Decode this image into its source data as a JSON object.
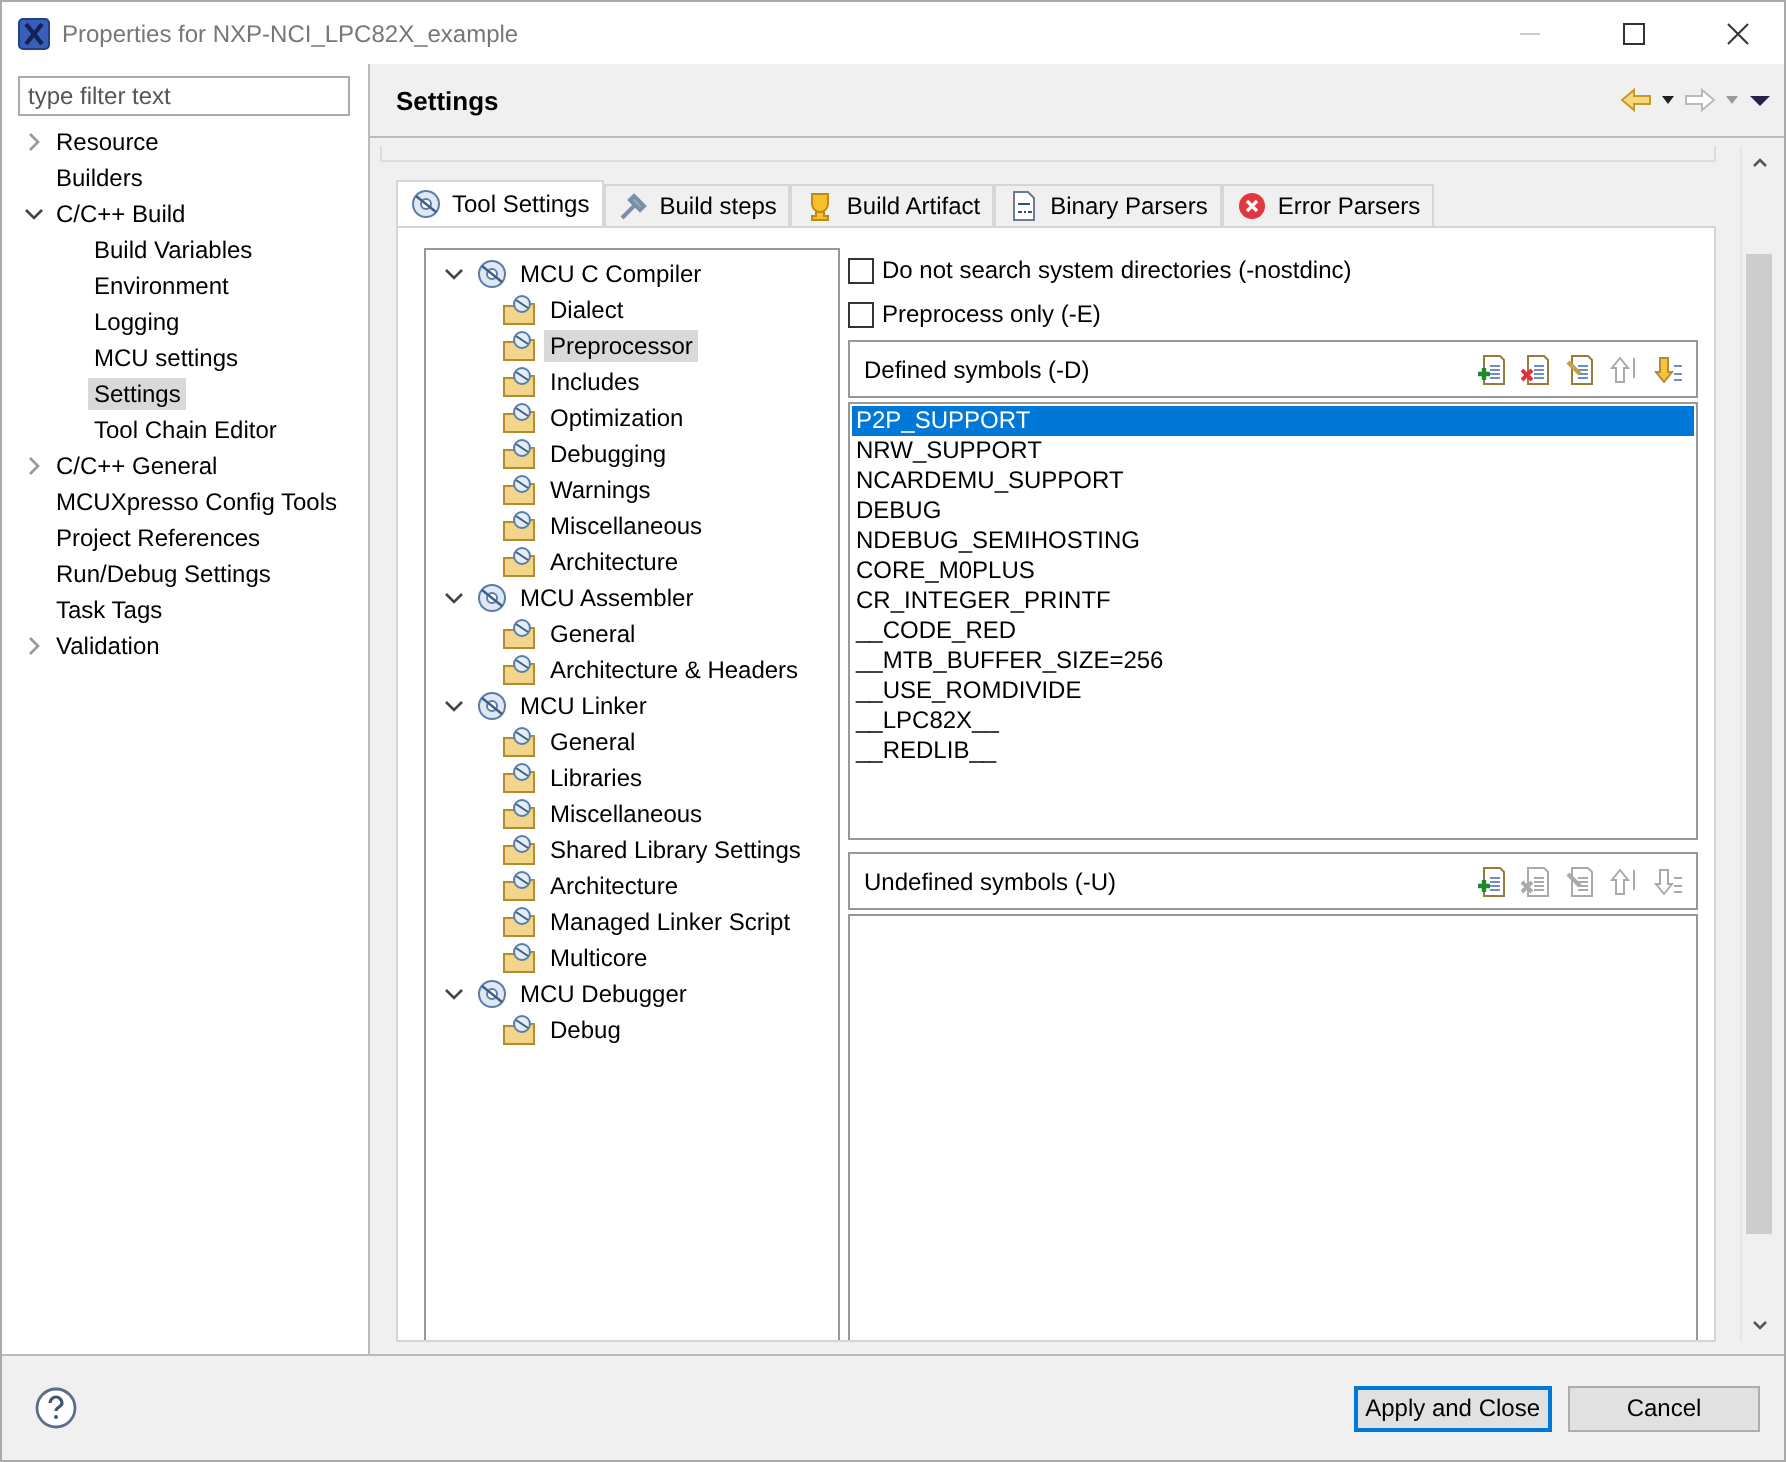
{
  "window": {
    "title": "Properties for NXP-NCI_LPC82X_example"
  },
  "sidebar": {
    "filter_placeholder": "type filter text",
    "items": [
      {
        "label": "Resource",
        "expanded": false,
        "selected": false
      },
      {
        "label": "Builders",
        "selected": false
      },
      {
        "label": "C/C++ Build",
        "expanded": true,
        "selected": false,
        "children": [
          {
            "label": "Build Variables",
            "selected": false
          },
          {
            "label": "Environment",
            "selected": false
          },
          {
            "label": "Logging",
            "selected": false
          },
          {
            "label": "MCU settings",
            "selected": false
          },
          {
            "label": "Settings",
            "selected": true
          },
          {
            "label": "Tool Chain Editor",
            "selected": false
          }
        ]
      },
      {
        "label": "C/C++ General",
        "expanded": false,
        "selected": false
      },
      {
        "label": "MCUXpresso Config Tools",
        "selected": false
      },
      {
        "label": "Project References",
        "selected": false
      },
      {
        "label": "Run/Debug Settings",
        "selected": false
      },
      {
        "label": "Task Tags",
        "selected": false
      },
      {
        "label": "Validation",
        "expanded": false,
        "selected": false
      }
    ]
  },
  "header": {
    "title": "Settings"
  },
  "tabs": [
    {
      "label": "Tool Settings",
      "selected": true
    },
    {
      "label": "Build steps",
      "selected": false
    },
    {
      "label": "Build Artifact",
      "selected": false
    },
    {
      "label": "Binary Parsers",
      "selected": false
    },
    {
      "label": "Error Parsers",
      "selected": false
    }
  ],
  "tool_tree": [
    {
      "label": "MCU C Compiler",
      "expanded": true,
      "children": [
        {
          "label": "Dialect",
          "selected": false
        },
        {
          "label": "Preprocessor",
          "selected": true
        },
        {
          "label": "Includes",
          "selected": false
        },
        {
          "label": "Optimization",
          "selected": false
        },
        {
          "label": "Debugging",
          "selected": false
        },
        {
          "label": "Warnings",
          "selected": false
        },
        {
          "label": "Miscellaneous",
          "selected": false
        },
        {
          "label": "Architecture",
          "selected": false
        }
      ]
    },
    {
      "label": "MCU Assembler",
      "expanded": true,
      "children": [
        {
          "label": "General",
          "selected": false
        },
        {
          "label": "Architecture & Headers",
          "selected": false
        }
      ]
    },
    {
      "label": "MCU Linker",
      "expanded": true,
      "children": [
        {
          "label": "General",
          "selected": false
        },
        {
          "label": "Libraries",
          "selected": false
        },
        {
          "label": "Miscellaneous",
          "selected": false
        },
        {
          "label": "Shared Library Settings",
          "selected": false
        },
        {
          "label": "Architecture",
          "selected": false
        },
        {
          "label": "Managed Linker Script",
          "selected": false
        },
        {
          "label": "Multicore",
          "selected": false
        }
      ]
    },
    {
      "label": "MCU Debugger",
      "expanded": true,
      "children": [
        {
          "label": "Debug",
          "selected": false
        }
      ]
    }
  ],
  "options": [
    {
      "label": "Do not search system directories (-nostdinc)",
      "checked": false
    },
    {
      "label": "Preprocess only (-E)",
      "checked": false
    }
  ],
  "symbol_lists": [
    {
      "title": "Defined symbols (-D)",
      "tools": [
        {
          "kind": "add",
          "disabled": false
        },
        {
          "kind": "delete",
          "disabled": false
        },
        {
          "kind": "edit",
          "disabled": false
        },
        {
          "kind": "up",
          "disabled": true
        },
        {
          "kind": "down",
          "disabled": false
        }
      ],
      "items": [
        {
          "label": "P2P_SUPPORT",
          "selected": true
        },
        {
          "label": "NRW_SUPPORT",
          "selected": false
        },
        {
          "label": "NCARDEMU_SUPPORT",
          "selected": false
        },
        {
          "label": "DEBUG",
          "selected": false
        },
        {
          "label": "NDEBUG_SEMIHOSTING",
          "selected": false
        },
        {
          "label": "CORE_M0PLUS",
          "selected": false
        },
        {
          "label": "CR_INTEGER_PRINTF",
          "selected": false
        },
        {
          "label": "__CODE_RED",
          "selected": false
        },
        {
          "label": "__MTB_BUFFER_SIZE=256",
          "selected": false
        },
        {
          "label": "__USE_ROMDIVIDE",
          "selected": false
        },
        {
          "label": "__LPC82X__",
          "selected": false
        },
        {
          "label": "__REDLIB__",
          "selected": false
        }
      ]
    },
    {
      "title": "Undefined symbols (-U)",
      "tools": [
        {
          "kind": "add",
          "disabled": false
        },
        {
          "kind": "delete",
          "disabled": true
        },
        {
          "kind": "edit",
          "disabled": true
        },
        {
          "kind": "up",
          "disabled": true
        },
        {
          "kind": "down",
          "disabled": true
        }
      ]
    }
  ],
  "buttons": [
    {
      "label": "Apply and Close",
      "focused": true
    },
    {
      "label": "Cancel",
      "focused": false
    }
  ]
}
